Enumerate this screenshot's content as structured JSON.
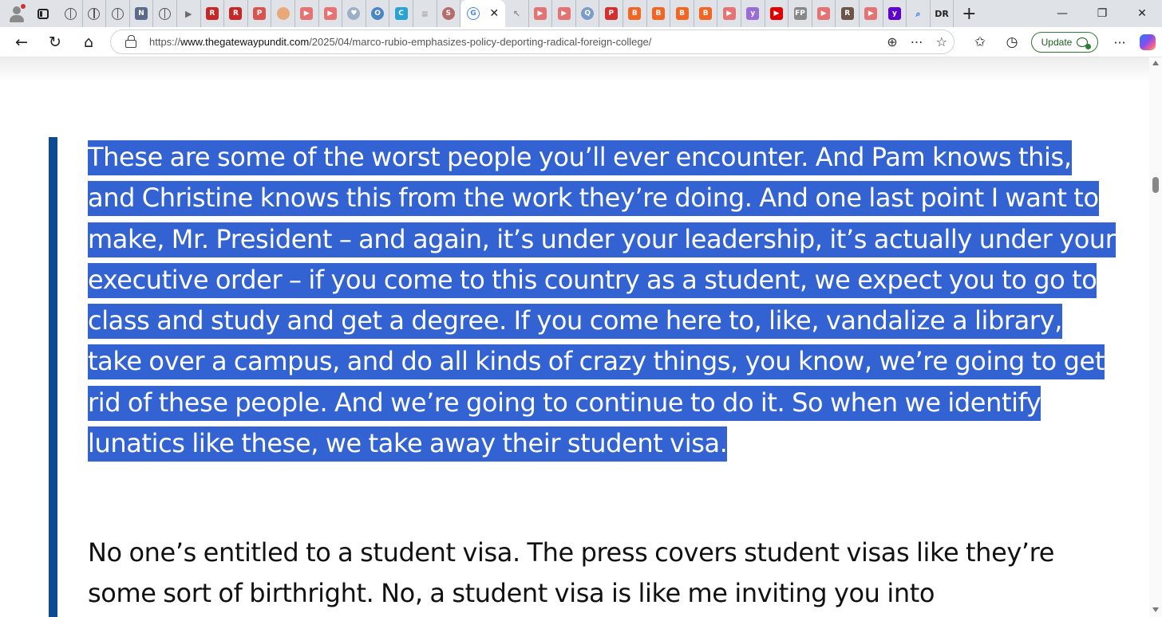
{
  "browser": {
    "tabs": [
      {
        "icon": "globe-icon",
        "color": "#555555",
        "text": ""
      },
      {
        "icon": "globe-icon",
        "color": "#555555",
        "text": ""
      },
      {
        "icon": "globe-icon",
        "color": "#555555",
        "text": ""
      },
      {
        "icon": "news-icon",
        "color": "#5a6b8c",
        "text": "N"
      },
      {
        "icon": "globe-icon",
        "color": "#555555",
        "text": ""
      },
      {
        "icon": "arrow-icon",
        "color": "#6b6b6b",
        "text": "▶"
      },
      {
        "icon": "r-logo-icon",
        "color": "#c62828",
        "text": "R"
      },
      {
        "icon": "r-logo-icon",
        "color": "#c62828",
        "text": "R"
      },
      {
        "icon": "pdf-icon",
        "color": "#d9534f",
        "text": "P"
      },
      {
        "icon": "circle-icon",
        "color": "#e8a878",
        "text": ""
      },
      {
        "icon": "video-icon",
        "color": "#e57373",
        "text": "▶"
      },
      {
        "icon": "video-icon",
        "color": "#e57373",
        "text": "▶"
      },
      {
        "icon": "shield-icon",
        "color": "#9bb0c6",
        "text": "♥"
      },
      {
        "icon": "circle-icon",
        "color": "#4a86c5",
        "text": "O"
      },
      {
        "icon": "c-logo-icon",
        "color": "#29a3d6",
        "text": "C"
      },
      {
        "icon": "page-icon",
        "color": "#9aa3ad",
        "text": "≡"
      },
      {
        "icon": "circle-icon",
        "color": "#b86b6b",
        "text": "S"
      },
      {
        "icon": "google-icon",
        "color": "#4285f4",
        "text": "G"
      },
      {
        "icon": "cursor-icon",
        "color": "#8a8a8a",
        "text": "↖"
      },
      {
        "icon": "video-icon",
        "color": "#e57373",
        "text": "▶"
      },
      {
        "icon": "video-icon",
        "color": "#e57373",
        "text": "▶"
      },
      {
        "icon": "circle-icon",
        "color": "#7a9cc6",
        "text": "Q"
      },
      {
        "icon": "pdf-icon",
        "color": "#d32f2f",
        "text": "P"
      },
      {
        "icon": "bookmark-icon",
        "color": "#f26522",
        "text": "B"
      },
      {
        "icon": "bookmark-icon",
        "color": "#f26522",
        "text": "B"
      },
      {
        "icon": "bookmark-icon",
        "color": "#f26522",
        "text": "B"
      },
      {
        "icon": "bookmark-icon",
        "color": "#f26522",
        "text": "B"
      },
      {
        "icon": "video-icon",
        "color": "#e57373",
        "text": "▶"
      },
      {
        "icon": "yahoo-icon",
        "color": "#9b6bd6",
        "text": "y"
      },
      {
        "icon": "youtube-icon",
        "color": "#e00000",
        "text": "▶"
      },
      {
        "icon": "fp-icon",
        "color": "#888888",
        "text": "FP"
      },
      {
        "icon": "video-icon",
        "color": "#e57373",
        "text": "▶"
      },
      {
        "icon": "r-logo-icon",
        "color": "#6d5548",
        "text": "R"
      },
      {
        "icon": "video-icon",
        "color": "#e57373",
        "text": "▶"
      },
      {
        "icon": "yahoo-icon",
        "color": "#5f01d1",
        "text": "y"
      },
      {
        "icon": "search-icon",
        "color": "#1a73e8",
        "text": "⌕"
      },
      {
        "icon": "dr-icon",
        "color": "#222222",
        "text": "DR"
      }
    ],
    "active_tab_icon": "google-icon",
    "active_tab_letter": "G",
    "active_tab_close": "✕",
    "new_tab": "+",
    "window_controls": {
      "minimize": "—",
      "maximize": "❐",
      "close": "✕"
    },
    "nav": {
      "back": "←",
      "reload": "↻",
      "home": "⌂"
    },
    "url": {
      "scheme": "https://",
      "host": "www.thegatewaypundit.com",
      "path": "/2025/04/marco-rubio-emphasizes-policy-deporting-radical-foreign-college/"
    },
    "url_actions": {
      "zoom": "⊕",
      "more_tools": "⋯",
      "favorite": "☆"
    },
    "tools": {
      "favorites": "✩",
      "history": "◷"
    },
    "update_label": "Update",
    "menu": "···"
  },
  "article": {
    "quote": "These are some of the worst people you’ll ever encounter. And Pam knows this, and Christine knows this from the work they’re doing. And one last point I want to make, Mr. President – and again, it’s under your leadership, it’s actually under your executive order – if you come to this country as a student, we expect you to go to class and study and get a degree. If you come here to, like, vandalize a library, take over a campus, and do all kinds of crazy things, you know, we’re going to get rid of these people. And we’re going to continue to do it. So when we identify lunatics like these, we take away their student visa.",
    "paragraph": "No one’s entitled to a student visa. The press covers student visas like they’re some sort of birthright. No, a student visa is like me inviting you into"
  },
  "colors": {
    "selection": "#3363d3",
    "quote_bar": "#0c4b94",
    "tabstrip": "#dfe3e8",
    "update_green": "#2e7d32"
  }
}
